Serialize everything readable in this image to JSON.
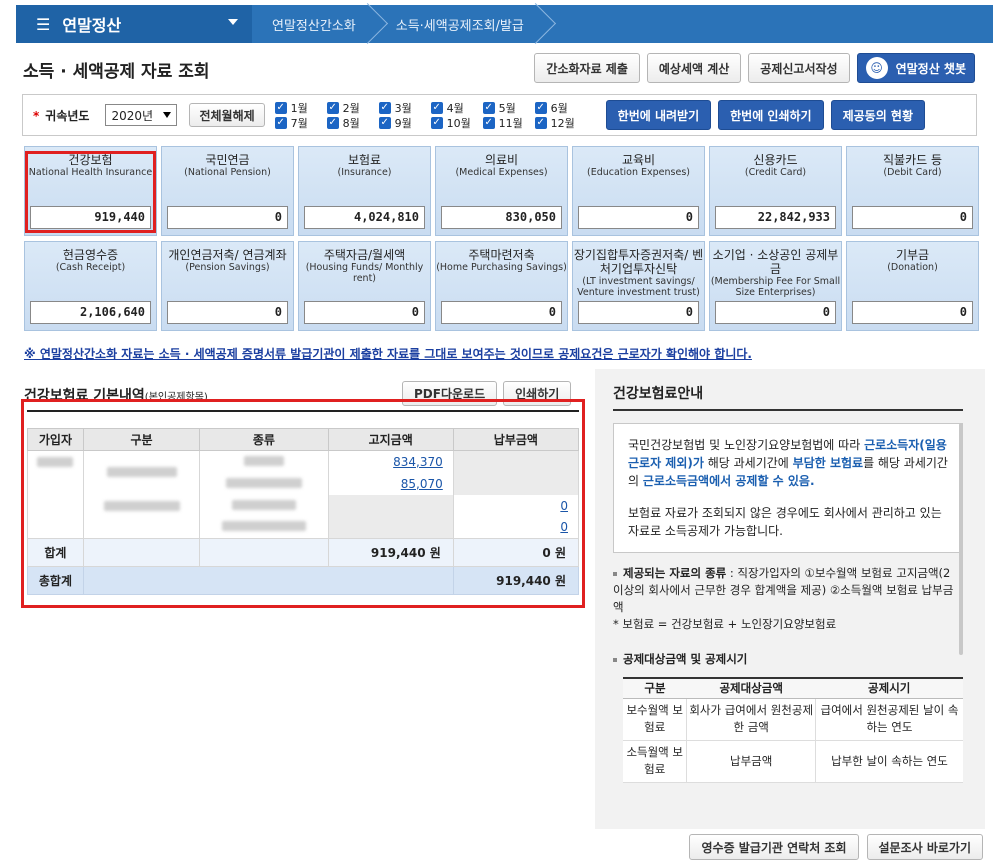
{
  "nav": {
    "home": "연말정산",
    "crumbs": [
      "연말정산간소화",
      "소득·세액공제조회/발급"
    ]
  },
  "page_title": "소득 · 세액공제 자료 조회",
  "top_buttons": [
    "간소화자료 제출",
    "예상세액 계산",
    "공제신고서작성",
    "연말정산 챗봇"
  ],
  "filter": {
    "year_label": "귀속년도",
    "year_value": "2020년",
    "toggle_all": "전체월해제",
    "months_top": [
      "1월",
      "2월",
      "3월",
      "4월",
      "5월",
      "6월"
    ],
    "months_bottom": [
      "7월",
      "8월",
      "9월",
      "10월",
      "11월",
      "12월"
    ],
    "actions": [
      "한번에 내려받기",
      "한번에 인쇄하기",
      "제공동의 현황"
    ]
  },
  "cards_row1": [
    {
      "ko": "건강보험",
      "en": "(National Health Insurance)",
      "value": "919,440"
    },
    {
      "ko": "국민연금",
      "en": "(National Pension)",
      "value": "0"
    },
    {
      "ko": "보험료",
      "en": "(Insurance)",
      "value": "4,024,810"
    },
    {
      "ko": "의료비",
      "en": "(Medical Expenses)",
      "value": "830,050"
    },
    {
      "ko": "교육비",
      "en": "(Education Expenses)",
      "value": "0"
    },
    {
      "ko": "신용카드",
      "en": "(Credit Card)",
      "value": "22,842,933"
    },
    {
      "ko": "직불카드 등",
      "en": "(Debit Card)",
      "value": "0"
    }
  ],
  "cards_row2": [
    {
      "ko": "현금영수증",
      "en": "(Cash Receipt)",
      "value": "2,106,640"
    },
    {
      "ko": "개인연금저축/ 연금계좌",
      "en": "(Pension Savings)",
      "value": "0"
    },
    {
      "ko": "주택자금/월세액",
      "en": "(Housing Funds/ Monthly rent)",
      "value": "0"
    },
    {
      "ko": "주택마련저축",
      "en": "(Home Purchasing Savings)",
      "value": "0"
    },
    {
      "ko": "장기집합투자증권저축/ 벤처기업투자신탁",
      "en": "(LT investment savings/ Venture investment trust)",
      "value": "0"
    },
    {
      "ko": "소기업 · 소상공인 공제부금",
      "en": "(Membership Fee For Small Size Enterprises)",
      "value": "0"
    },
    {
      "ko": "기부금",
      "en": "(Donation)",
      "value": "0"
    }
  ],
  "notice": "※ 연말정산간소화 자료는 소득 · 세액공제 증명서류 발급기관이 제출한 자료를 그대로 보여주는 것이므로 공제요건은 근로자가 확인해야 합니다.",
  "basic": {
    "title": "건강보험료 기본내역",
    "subtitle": "(본인공제항목)",
    "buttons": [
      "PDF다운로드",
      "인쇄하기"
    ],
    "headers": [
      "가입자",
      "구분",
      "종류",
      "고지금액",
      "납부금액"
    ],
    "rows": [
      {
        "notice": "834,370",
        "paid": ""
      },
      {
        "notice": "85,070",
        "paid": ""
      },
      {
        "notice": "",
        "paid": "0"
      },
      {
        "notice": "",
        "paid": "0"
      }
    ],
    "sum_label": "합계",
    "sum_notice": "919,440 원",
    "sum_paid": "0 원",
    "total_label": "총합계",
    "total_value": "919,440 원"
  },
  "guide": {
    "title": "건강보험료안내",
    "p1_a": "국민건강보험법 및 노인장기요양보험법에 따라 ",
    "p1_b": "근로소득자(일용근로자 제외)가",
    "p1_c": " 해당 과세기간에 ",
    "p1_d": "부담한 보험료",
    "p1_e": "를 해당 과세기간의 ",
    "p1_f": "근로소득금액에서 공제할 수 있음.",
    "p2": "보험료 자료가 조회되지 않은 경우에도 회사에서 관리하고 있는 자료로 소득공제가 가능합니다.",
    "sec1_title": "제공되는 자료의 종류",
    "sec1_body": " : 직장가입자의 ①보수월액 보험료 고지금액(2 이상의 회사에서 근무한 경우 합계액을 제공) ②소득월액 보험료 납부금액",
    "sec1_note": "* 보험료 = 건강보험료 + 노인장기요양보험료",
    "sec2_title": "공제대상금액 및 공제시기",
    "table_headers": [
      "구분",
      "공제대상금액",
      "공제시기"
    ],
    "table_rows": [
      [
        "보수월액 보험료",
        "회사가 급여에서 원천공제한 금액",
        "급여에서 원천공제된 날이 속하는 연도"
      ],
      [
        "소득월액 보험료",
        "납부금액",
        "납부한 날이 속하는 연도"
      ]
    ]
  },
  "bottom_buttons": [
    "영수증 발급기관 연락처 조회",
    "설문조사 바로가기"
  ]
}
